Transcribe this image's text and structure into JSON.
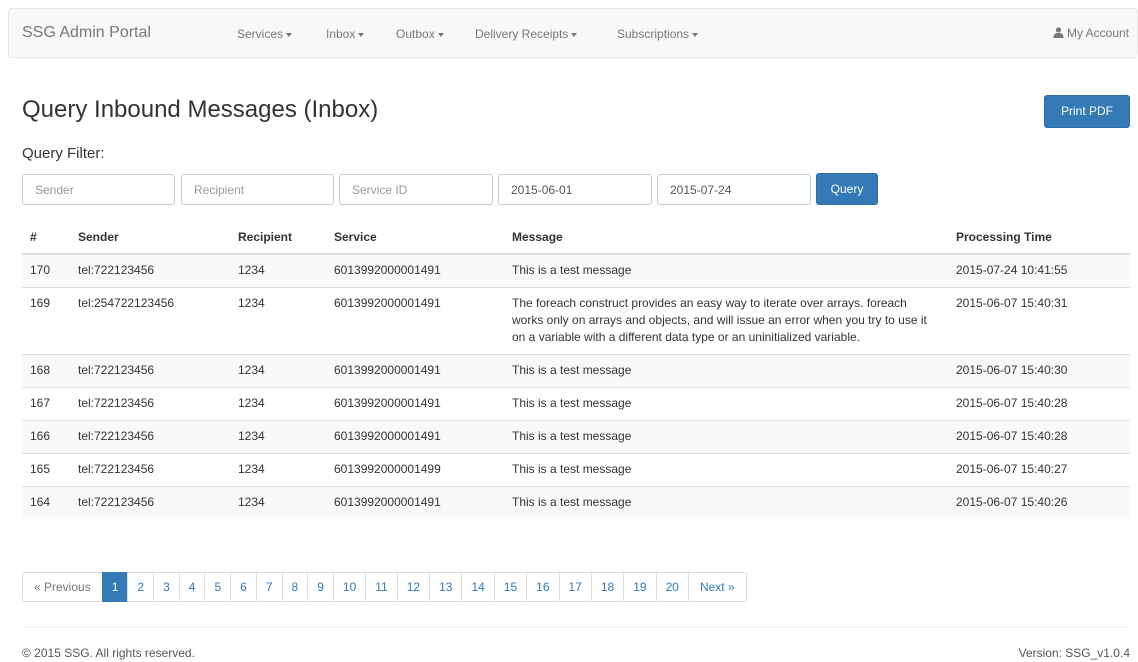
{
  "navbar": {
    "brand": "SSG Admin Portal",
    "menus": [
      {
        "label": "Services"
      },
      {
        "label": "Inbox"
      },
      {
        "label": "Outbox"
      },
      {
        "label": "Delivery Receipts"
      },
      {
        "label": "Subscriptions"
      }
    ],
    "account_label": "My Account",
    "account_icon": "user-icon"
  },
  "header": {
    "title": "Query Inbound Messages (Inbox)",
    "print_label": "Print PDF"
  },
  "filter": {
    "label": "Query Filter:",
    "sender_placeholder": "Sender",
    "recipient_placeholder": "Recipient",
    "service_placeholder": "Service ID",
    "start_date": "2015-06-01",
    "end_date": "2015-07-24",
    "query_label": "Query"
  },
  "table": {
    "columns": [
      "#",
      "Sender",
      "Recipient",
      "Service",
      "Message",
      "Processing Time"
    ],
    "rows": [
      {
        "id": "170",
        "sender": "tel:722123456",
        "recipient": "1234",
        "service": "6013992000001491",
        "message": "This is a test message",
        "time": "2015-07-24 10:41:55"
      },
      {
        "id": "169",
        "sender": "tel:254722123456",
        "recipient": "1234",
        "service": "6013992000001491",
        "message": "The foreach construct provides an easy way to iterate over arrays. foreach works only on arrays and objects, and will issue an error when you try to use it on a variable with a different data type or an uninitialized variable.",
        "time": "2015-06-07 15:40:31"
      },
      {
        "id": "168",
        "sender": "tel:722123456",
        "recipient": "1234",
        "service": "6013992000001491",
        "message": "This is a test message",
        "time": "2015-06-07 15:40:30"
      },
      {
        "id": "167",
        "sender": "tel:722123456",
        "recipient": "1234",
        "service": "6013992000001491",
        "message": "This is a test message",
        "time": "2015-06-07 15:40:28"
      },
      {
        "id": "166",
        "sender": "tel:722123456",
        "recipient": "1234",
        "service": "6013992000001491",
        "message": "This is a test message",
        "time": "2015-06-07 15:40:28"
      },
      {
        "id": "165",
        "sender": "tel:722123456",
        "recipient": "1234",
        "service": "6013992000001499",
        "message": "This is a test message",
        "time": "2015-06-07 15:40:27"
      },
      {
        "id": "164",
        "sender": "tel:722123456",
        "recipient": "1234",
        "service": "6013992000001491",
        "message": "This is a test message",
        "time": "2015-06-07 15:40:26"
      }
    ]
  },
  "pagination": {
    "prev_label": "« Previous",
    "next_label": "Next »",
    "pages": [
      "1",
      "2",
      "3",
      "4",
      "5",
      "6",
      "7",
      "8",
      "9",
      "10",
      "11",
      "12",
      "13",
      "14",
      "15",
      "16",
      "17",
      "18",
      "19",
      "20"
    ],
    "current": "1"
  },
  "footer": {
    "copyright": "© 2015 SSG. All rights reserved.",
    "version": "Version: SSG_v1.0.4"
  },
  "colors": {
    "primary": "#337ab7",
    "navbar_bg": "#f8f8f8",
    "stripe": "#f9f9f9"
  }
}
